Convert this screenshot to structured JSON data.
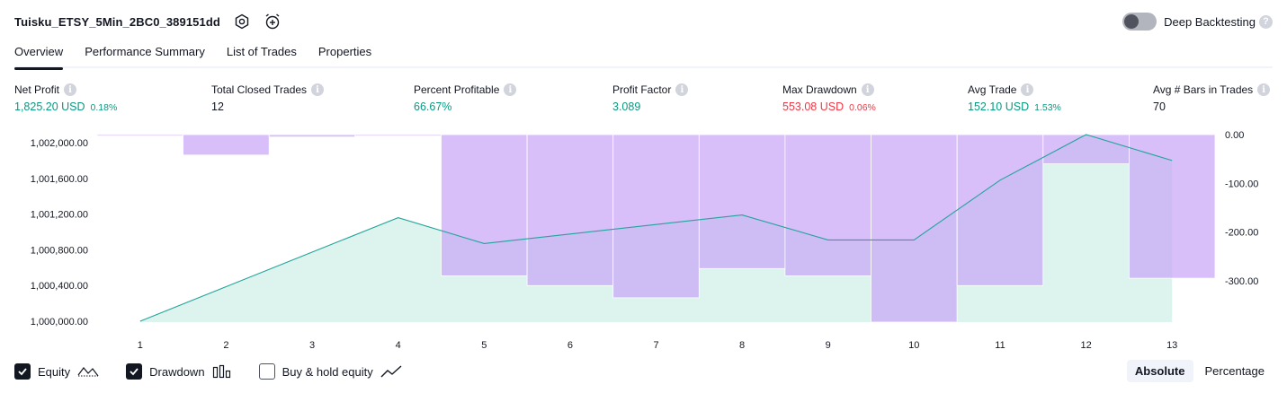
{
  "header": {
    "title": "Tuisku_ETSY_5Min_2BC0_389151dd",
    "settings_icon": "gear-icon",
    "alert_icon": "alarm-clock-plus-icon"
  },
  "deep_backtesting": {
    "label": "Deep Backtesting",
    "enabled": false,
    "help": "?"
  },
  "tabs": [
    "Overview",
    "Performance Summary",
    "List of Trades",
    "Properties"
  ],
  "active_tab": "Overview",
  "metrics": [
    {
      "label": "Net Profit",
      "value": "1,825.20 USD",
      "pct": "0.18%",
      "tone": "green"
    },
    {
      "label": "Total Closed Trades",
      "value": "12",
      "pct": "",
      "tone": "plain"
    },
    {
      "label": "Percent Profitable",
      "value": "66.67%",
      "pct": "",
      "tone": "green"
    },
    {
      "label": "Profit Factor",
      "value": "3.089",
      "pct": "",
      "tone": "green"
    },
    {
      "label": "Max Drawdown",
      "value": "553.08 USD",
      "pct": "0.06%",
      "tone": "red"
    },
    {
      "label": "Avg Trade",
      "value": "152.10 USD",
      "pct": "1.53%",
      "tone": "green"
    },
    {
      "label": "Avg # Bars in Trades",
      "value": "70",
      "pct": "",
      "tone": "plain"
    }
  ],
  "info_glyph": "i",
  "colors": {
    "equity_line": "#22a49a",
    "equity_fill": "#d6f1eb",
    "drawdown_bar": "#c9a6f7",
    "positive": "#089981",
    "negative": "#f23645"
  },
  "chart_data": {
    "type": "line+bar",
    "x": [
      1,
      2,
      3,
      4,
      5,
      6,
      7,
      8,
      9,
      10,
      11,
      12,
      13
    ],
    "left_axis": {
      "ticks": [
        1000000,
        1000400,
        1000800,
        1001200,
        1001600,
        1002000
      ],
      "tick_labels": [
        "1,000,000.00",
        "1,000,400.00",
        "1,000,800.00",
        "1,001,200.00",
        "1,001,600.00",
        "1,002,000.00"
      ],
      "range": [
        999990,
        1002090
      ]
    },
    "right_axis": {
      "ticks": [
        0,
        -100,
        -200,
        -300
      ],
      "tick_labels": [
        "0.00",
        "-100.00",
        "-200.00",
        "-300.00"
      ],
      "range": [
        -385,
        0
      ]
    },
    "series": [
      {
        "name": "Equity",
        "type": "area",
        "axis": "left",
        "values": [
          1000000,
          null,
          null,
          1001160,
          1000870,
          null,
          null,
          1001190,
          1000910,
          1000910,
          1001580,
          1002090,
          1001800
        ]
      },
      {
        "name": "Drawdown",
        "type": "bar",
        "axis": "right",
        "values": [
          0,
          -42,
          -5,
          0,
          -290,
          -310,
          -335,
          -275,
          -290,
          -385,
          -310,
          -60,
          -295
        ]
      }
    ],
    "grid": false
  },
  "legend": [
    {
      "label": "Equity",
      "checked": true,
      "icon": "area-line-icon"
    },
    {
      "label": "Drawdown",
      "checked": true,
      "icon": "bars-icon"
    },
    {
      "label": "Buy & hold equity",
      "checked": false,
      "icon": "line-icon"
    }
  ],
  "modes": [
    "Absolute",
    "Percentage"
  ],
  "active_mode": "Absolute"
}
